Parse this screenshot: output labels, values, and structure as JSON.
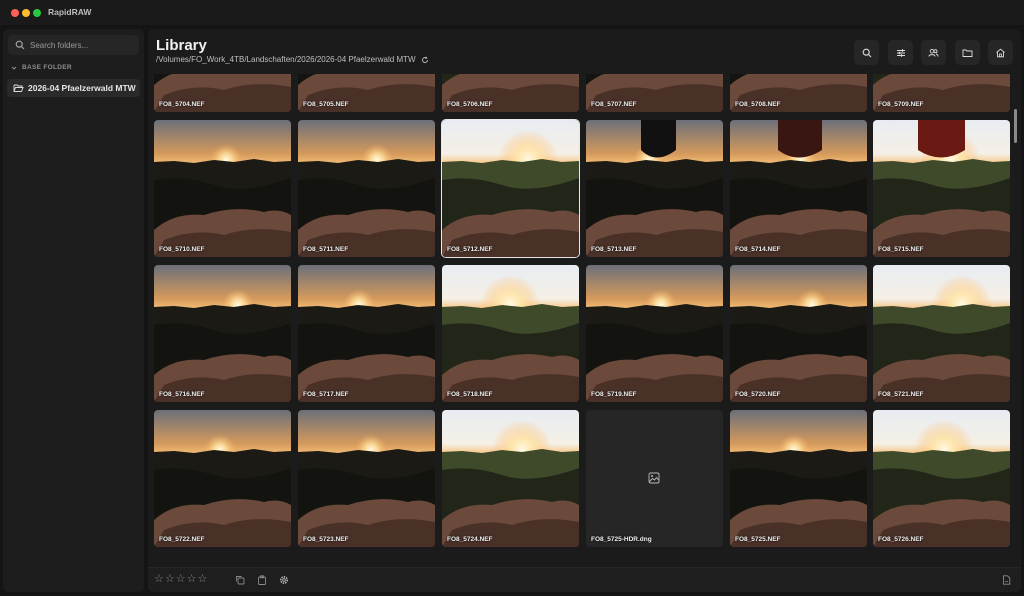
{
  "app": {
    "title": "RapidRAW"
  },
  "sidebar": {
    "search_placeholder": "Search folders...",
    "base_folder_label": "BASE FOLDER",
    "folders": [
      {
        "label": "2026-04 Pfaelzerwald MTW"
      }
    ]
  },
  "library": {
    "title": "Library",
    "path": "/Volumes/FO_Work_4TB/Landschaften/2026/2026-04 Pfaelzerwald MTW"
  },
  "toolbar": {
    "buttons": [
      "search-icon",
      "sliders-icon",
      "people-icon",
      "folder-icon",
      "home-icon"
    ]
  },
  "thumbnails": [
    {
      "name": "FO8_5704.NEF"
    },
    {
      "name": "FO8_5705.NEF"
    },
    {
      "name": "FO8_5706.NEF"
    },
    {
      "name": "FO8_5707.NEF"
    },
    {
      "name": "FO8_5708.NEF"
    },
    {
      "name": "FO8_5709.NEF"
    },
    {
      "name": "FO8_5710.NEF"
    },
    {
      "name": "FO8_5711.NEF"
    },
    {
      "name": "FO8_5712.NEF"
    },
    {
      "name": "FO8_5713.NEF"
    },
    {
      "name": "FO8_5714.NEF"
    },
    {
      "name": "FO8_5715.NEF"
    },
    {
      "name": "FO8_5716.NEF"
    },
    {
      "name": "FO8_5717.NEF"
    },
    {
      "name": "FO8_5718.NEF"
    },
    {
      "name": "FO8_5719.NEF"
    },
    {
      "name": "FO8_5720.NEF"
    },
    {
      "name": "FO8_5721.NEF"
    },
    {
      "name": "FO8_5722.NEF"
    },
    {
      "name": "FO8_5723.NEF"
    },
    {
      "name": "FO8_5724.NEF"
    },
    {
      "name": "FO8_5725-HDR.dng"
    },
    {
      "name": "FO8_5725.NEF"
    },
    {
      "name": "FO8_5726.NEF"
    }
  ],
  "selected_thumbnail": "FO8_5712.NEF",
  "rating": {
    "stars": 0,
    "max": 5
  },
  "colors": {
    "accent": "#ffffff",
    "background": "#141414",
    "panel": "#1b1b1b"
  }
}
